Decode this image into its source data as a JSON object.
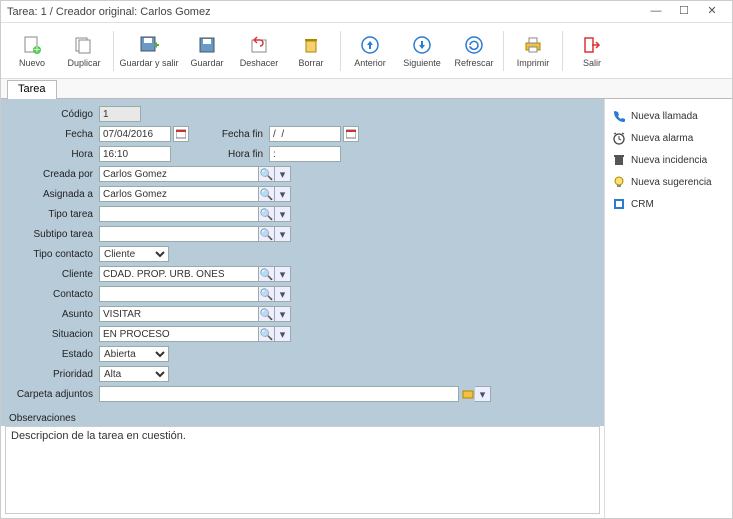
{
  "window": {
    "title": "Tarea: 1 / Creador original: Carlos Gomez"
  },
  "toolbar": {
    "nuevo": "Nuevo",
    "duplicar": "Duplicar",
    "guardar_salir": "Guardar y salir",
    "guardar": "Guardar",
    "deshacer": "Deshacer",
    "borrar": "Borrar",
    "anterior": "Anterior",
    "siguiente": "Siguiente",
    "refrescar": "Refrescar",
    "imprimir": "Imprimir",
    "salir": "Salir"
  },
  "tabs": {
    "tarea": "Tarea"
  },
  "labels": {
    "codigo": "Código",
    "fecha": "Fecha",
    "fecha_fin": "Fecha fin",
    "hora": "Hora",
    "hora_fin": "Hora fin",
    "creada_por": "Creada por",
    "asignada_a": "Asignada a",
    "tipo_tarea": "Tipo tarea",
    "subtipo_tarea": "Subtipo tarea",
    "tipo_contacto": "Tipo contacto",
    "cliente": "Cliente",
    "contacto": "Contacto",
    "asunto": "Asunto",
    "situacion": "Situacion",
    "estado": "Estado",
    "prioridad": "Prioridad",
    "carpeta_adjuntos": "Carpeta adjuntos",
    "observaciones": "Observaciones"
  },
  "values": {
    "codigo": "1",
    "fecha": "07/04/2016",
    "fecha_fin": "/  /",
    "hora": "16:10",
    "hora_fin": ":",
    "creada_por": "Carlos Gomez",
    "asignada_a": "Carlos Gomez",
    "tipo_tarea": "",
    "subtipo_tarea": "",
    "tipo_contacto": "Cliente",
    "cliente": "CDAD. PROP. URB. ONES",
    "contacto": "",
    "asunto": "VISITAR",
    "situacion": "EN PROCESO",
    "estado": "Abierta",
    "prioridad": "Alta",
    "carpeta_adjuntos": "",
    "observaciones": "Descripcion de la tarea en cuestión."
  },
  "side": {
    "nueva_llamada": "Nueva llamada",
    "nueva_alarma": "Nueva alarma",
    "nueva_incidencia": "Nueva incidencia",
    "nueva_sugerencia": "Nueva sugerencia",
    "crm": "CRM"
  }
}
